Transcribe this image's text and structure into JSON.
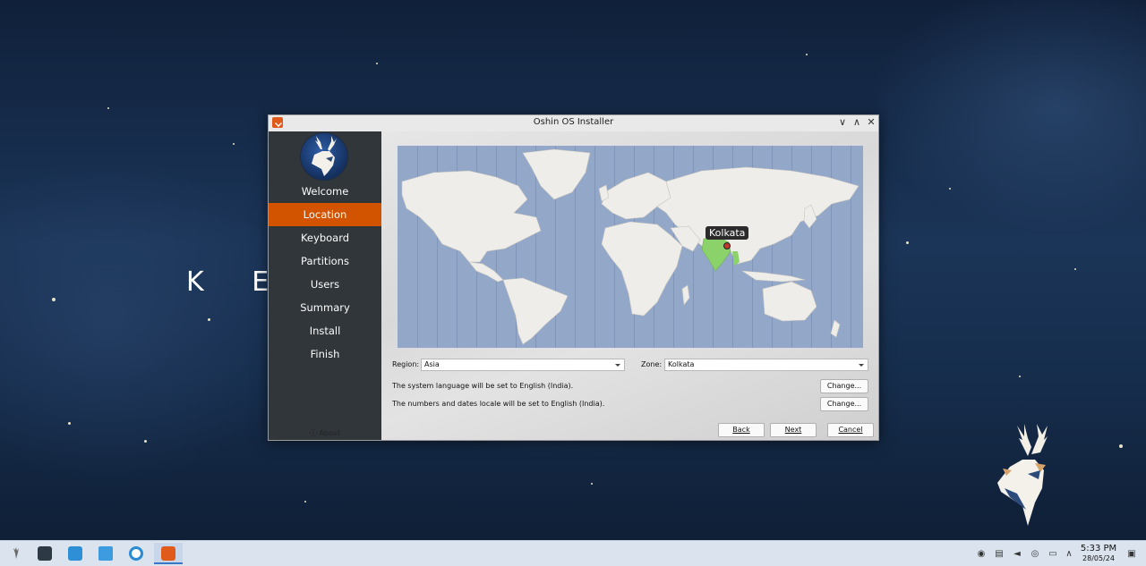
{
  "desktop": {
    "watermark_text": "K E",
    "logo_icon": "deer-logo"
  },
  "window": {
    "title": "Oshin OS Installer",
    "app_icon": "installer-download-icon",
    "controls": {
      "minimize": "∨",
      "maximize": "∧",
      "close": "✕"
    }
  },
  "sidebar": {
    "logo_icon": "deer-logo",
    "items": [
      {
        "label": "Welcome",
        "active": false
      },
      {
        "label": "Location",
        "active": true
      },
      {
        "label": "Keyboard",
        "active": false
      },
      {
        "label": "Partitions",
        "active": false
      },
      {
        "label": "Users",
        "active": false
      },
      {
        "label": "Summary",
        "active": false
      },
      {
        "label": "Install",
        "active": false
      },
      {
        "label": "Finish",
        "active": false
      }
    ],
    "about_label": "About",
    "active_color": "#d35400"
  },
  "map": {
    "selected_city": "Kolkata"
  },
  "location": {
    "region_label": "Region:",
    "region_value": "Asia",
    "zone_label": "Zone:",
    "zone_value": "Kolkata"
  },
  "locale": {
    "language_text": "The system language will be set to English (India).",
    "numbers_text": "The numbers and dates locale will be set to English (India).",
    "change_label": "Change..."
  },
  "buttons": {
    "back": "Back",
    "next": "Next",
    "cancel": "Cancel"
  },
  "taskbar": {
    "apps": [
      {
        "name": "app-launcher-icon"
      },
      {
        "name": "terminal-icon"
      },
      {
        "name": "discover-store-icon"
      },
      {
        "name": "file-manager-icon"
      },
      {
        "name": "browser-icon"
      },
      {
        "name": "installer-icon",
        "active": true
      }
    ],
    "tray": [
      "network-icon",
      "clipboard-icon",
      "volume-icon",
      "vpn-icon",
      "display-icon",
      "expand-tray-icon"
    ],
    "time": "5:33 PM",
    "date": "28/05/24"
  }
}
